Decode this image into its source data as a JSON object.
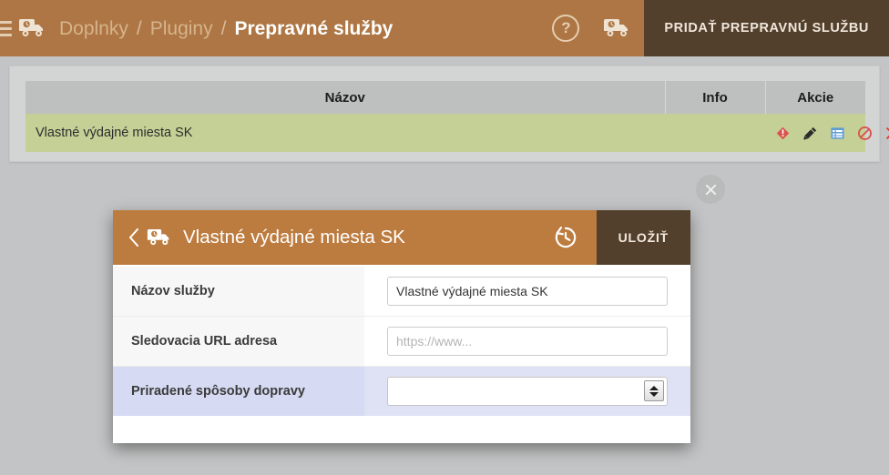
{
  "header": {
    "menu_icon": "hamburger-icon",
    "brand_icon": "delivery-truck-icon",
    "breadcrumb": [
      {
        "label": "Doplnky",
        "current": false
      },
      {
        "label": "Pluginy",
        "current": false
      },
      {
        "label": "Prepravné služby",
        "current": true
      }
    ],
    "separator": "/",
    "help_icon": "question-mark-icon",
    "help_glyph": "?",
    "truck_icon": "delivery-truck-icon",
    "add_button_label": "PRIDAŤ PREPRAVNÚ SLUŽBU",
    "bar_color": "#ad7644",
    "button_color": "#53402c"
  },
  "table": {
    "columns": [
      "Názov",
      "Info",
      "Akcie"
    ],
    "rows": [
      {
        "name": "Vlastné výdajné miesta SK",
        "info": "",
        "actions": [
          {
            "icon": "warning-diamond-icon",
            "color": "#d9534f"
          },
          {
            "icon": "edit-pencil-icon",
            "color": "#2b2b2b"
          },
          {
            "icon": "list-table-icon",
            "color": "#5b9bd5"
          },
          {
            "icon": "ban-disable-icon",
            "color": "#d9534f"
          },
          {
            "icon": "delete-x-icon",
            "color": "#e23b2e"
          }
        ]
      }
    ],
    "row_color": "#c5d096",
    "header_color": "#bebfbf"
  },
  "close_button": {
    "icon": "close-x-icon",
    "label": "×"
  },
  "modal": {
    "back_icon": "chevron-left-icon",
    "title_icon": "delivery-truck-icon",
    "title": "Vlastné výdajné miesta SK",
    "history_icon": "history-restore-icon",
    "save_label": "ULOŽIŤ",
    "header_color": "#bd7c3f",
    "fields": [
      {
        "label": "Názov služby",
        "type": "text",
        "value": "Vlastné výdajné miesta SK",
        "placeholder": "",
        "highlight": false
      },
      {
        "label": "Sledovacia URL adresa",
        "type": "text",
        "value": "",
        "placeholder": "https://www...",
        "highlight": false
      },
      {
        "label": "Priradené spôsoby dopravy",
        "type": "select",
        "value": "",
        "placeholder": "",
        "highlight": true
      }
    ]
  }
}
